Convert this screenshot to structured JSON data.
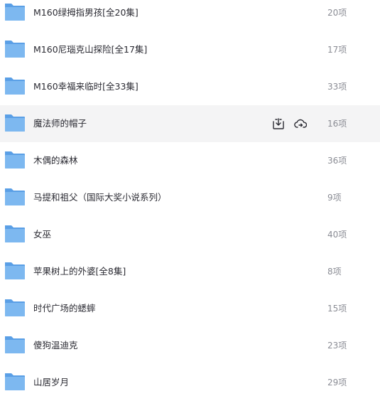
{
  "folders": [
    {
      "name": "M160绿拇指男孩[全20集]",
      "count": "20项",
      "hovered": false
    },
    {
      "name": "M160尼瑙克山探险[全17集]",
      "count": "17项",
      "hovered": false
    },
    {
      "name": "M160幸福来临时[全33集]",
      "count": "33项",
      "hovered": false
    },
    {
      "name": "魔法师的帽子",
      "count": "16项",
      "hovered": true
    },
    {
      "name": "木偶的森林",
      "count": "36项",
      "hovered": false
    },
    {
      "name": "马提和祖父（国际大奖小说系列）",
      "count": "9项",
      "hovered": false
    },
    {
      "name": "女巫",
      "count": "40项",
      "hovered": false
    },
    {
      "name": "苹果树上的外婆[全8集]",
      "count": "8项",
      "hovered": false
    },
    {
      "name": "时代广场的蟋蟀",
      "count": "15项",
      "hovered": false
    },
    {
      "name": "傻狗温迪克",
      "count": "23项",
      "hovered": false
    },
    {
      "name": "山居岁月",
      "count": "29项",
      "hovered": false
    }
  ],
  "icons": {
    "folder": "folder-icon",
    "download": "download-icon",
    "save_to_cloud": "cloud-save-icon"
  },
  "colors": {
    "folder_front": "#7db8f0",
    "folder_back": "#5a9fe6",
    "hover_bg": "#f4f4f5",
    "name_text": "#2b2b33",
    "count_text": "#8a8c94"
  }
}
